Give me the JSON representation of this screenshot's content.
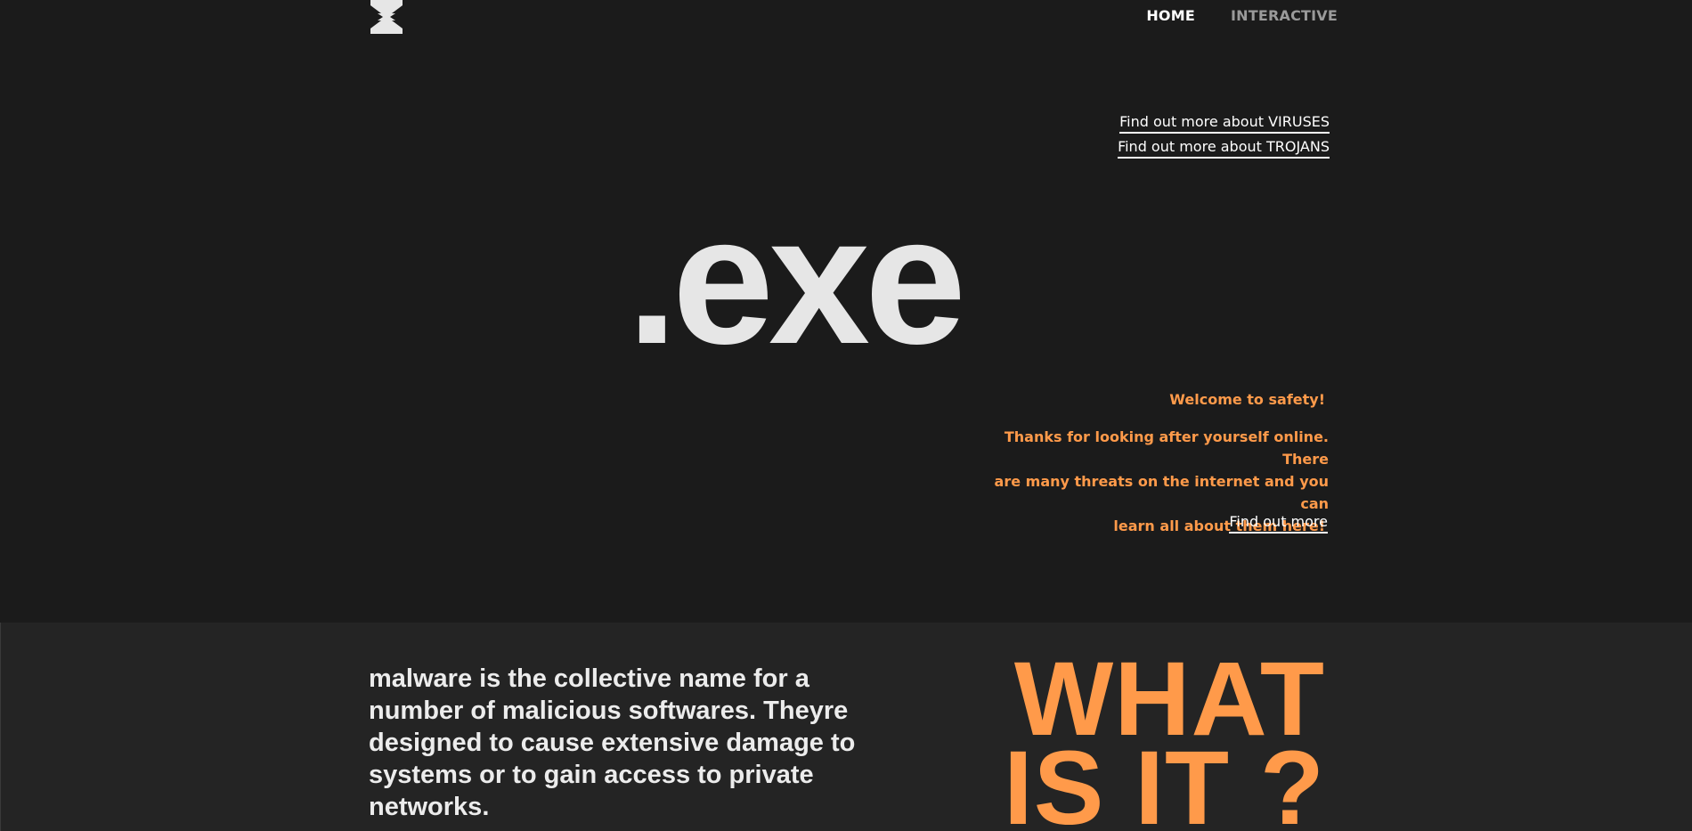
{
  "nav": {
    "logo_icon": "hourglass-logo-icon",
    "items": [
      {
        "label": "HOME",
        "active": true
      },
      {
        "label": "INTERACTIVE",
        "active": false
      }
    ]
  },
  "hero": {
    "links": [
      "Find out more about VIRUSES",
      "Find out more about TROJANS"
    ],
    "big_title": ".exe",
    "welcome_title": "Welcome to safety!",
    "welcome_lines": [
      "Thanks for looking after yourself online. There",
      "are many threats on the internet and you can",
      "learn all about them here!"
    ],
    "find_more_label": "Find out more"
  },
  "section2": {
    "description": "malware is the collective name for a number of malicious softwares. Theyre designed to cause extensive damage to systems or to gain access to private networks.",
    "title_line1": "WHAT",
    "title_line2": "IS IT ?"
  },
  "colors": {
    "background": "#1b1b1b",
    "section_bg": "#242424",
    "accent": "#ff9a4a",
    "text_light": "#e6e6e6"
  }
}
